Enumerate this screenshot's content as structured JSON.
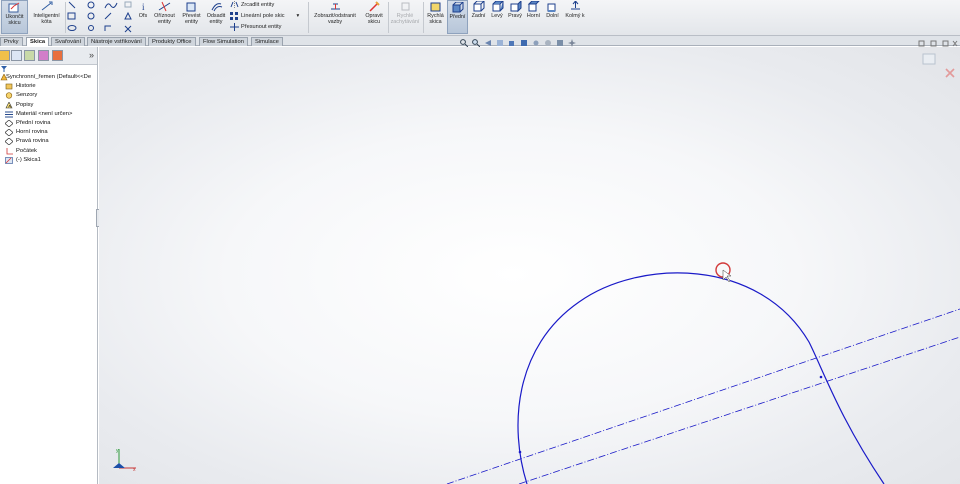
{
  "ribbon": {
    "sketch_button": "Ukončit skicu",
    "dimension_button": "Inteligentní kóta",
    "offset_button": "Ofs",
    "trim_button": "Oříznout entity",
    "convert_button": "Převést entity",
    "offset_entities_button": "Odsadit entity",
    "mirror_label": "Zrcadlit entity",
    "linear_pattern_label": "Lineární pole skic",
    "move_label": "Přesunout entity",
    "relations_button": "Zobrazit/odstranit vazby",
    "repair_button": "Opravit skicu",
    "quick_snaps_button": "Rychlé zachytávání",
    "rapid_sketch_button": "Rychlá skica",
    "views": [
      "Přední",
      "Zadní",
      "Levý",
      "Pravý",
      "Horní",
      "Dolní",
      "Kolmý k"
    ]
  },
  "tabs": [
    "Prvky",
    "Skica",
    "Svařování",
    "Nástroje vstřikování",
    "Produkty Office",
    "Flow Simulation",
    "Simulace"
  ],
  "tree": {
    "root": "Synchronní_řemen  (Default<<De",
    "items": [
      "Historie",
      "Senzory",
      "Popisy",
      "Materiál <není určen>",
      "Přední rovina",
      "Horní rovina",
      "Pravá rovina",
      "Počátek",
      "(-) Skica1"
    ]
  },
  "tree_collapse": "»",
  "colors": {
    "sketch_line": "#1a1ac8",
    "accent": "#5b87c5",
    "cursor_ring": "#d23a3a"
  }
}
